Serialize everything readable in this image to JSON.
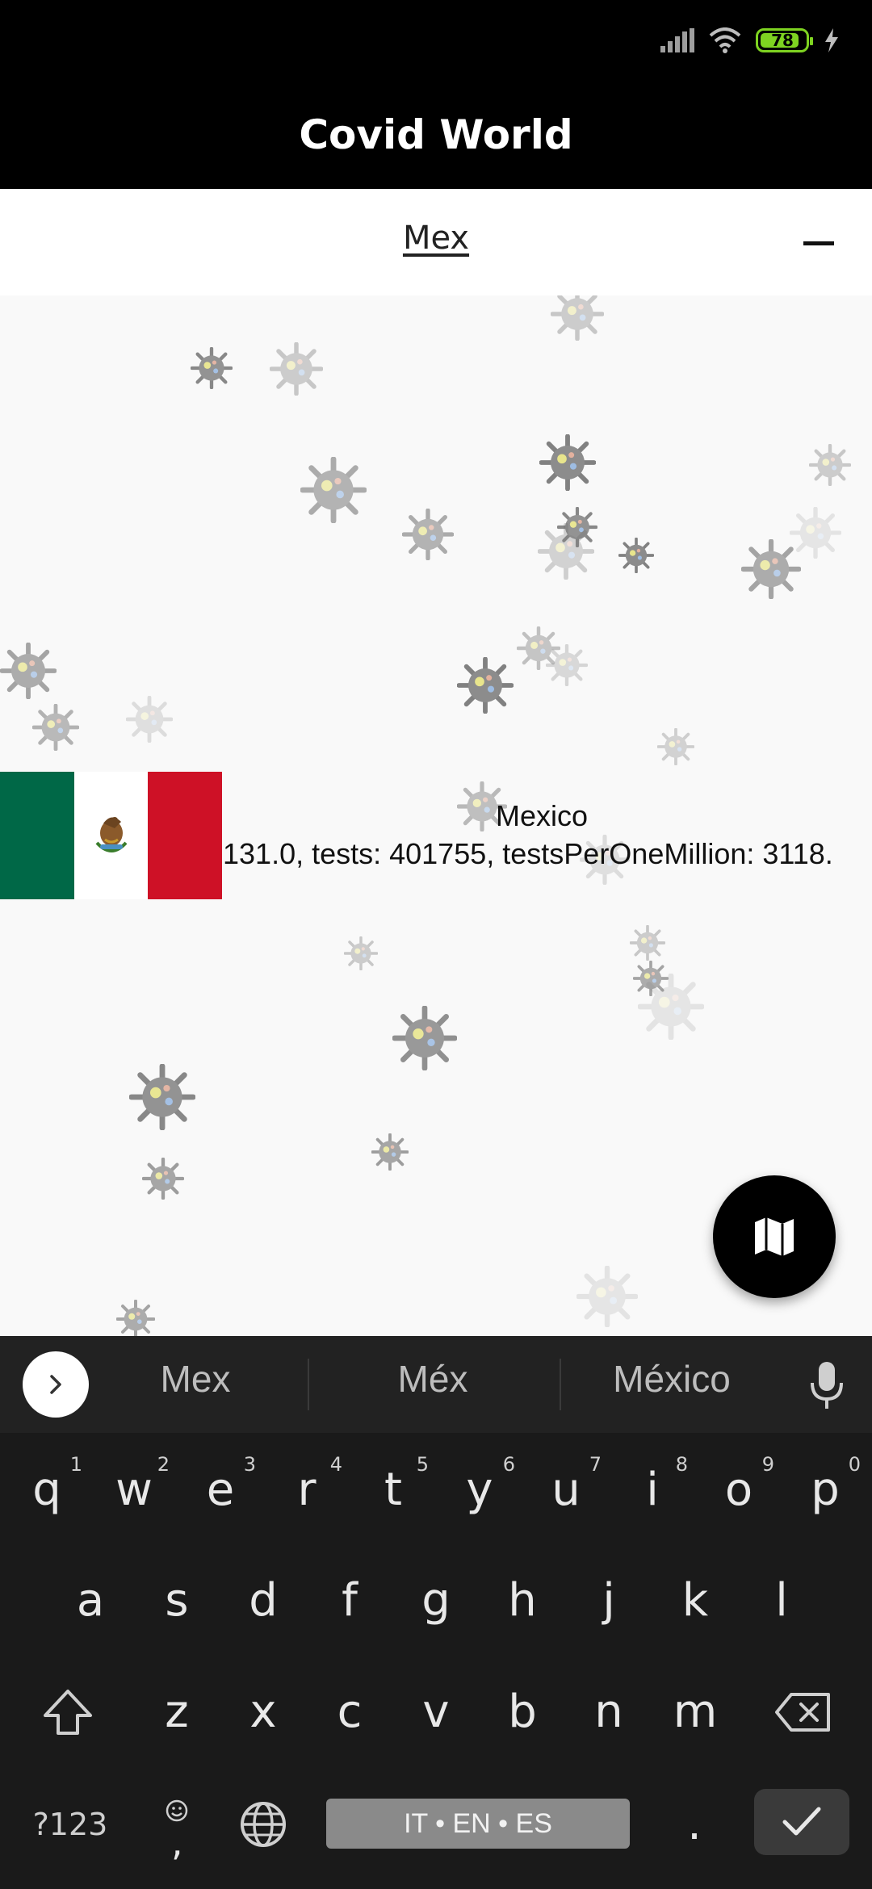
{
  "status_bar": {
    "battery_level": "78"
  },
  "app_bar": {
    "title": "Covid World"
  },
  "search": {
    "query": "Mex"
  },
  "country": {
    "name": "Mexico",
    "stats": "131.0, tests: 401755, testsPerOneMillion: 3118."
  },
  "fab": {
    "icon": "map-icon"
  },
  "keyboard": {
    "suggestions": [
      "Mex",
      "Méx",
      "México"
    ],
    "row1": [
      {
        "k": "q",
        "n": "1"
      },
      {
        "k": "w",
        "n": "2"
      },
      {
        "k": "e",
        "n": "3"
      },
      {
        "k": "r",
        "n": "4"
      },
      {
        "k": "t",
        "n": "5"
      },
      {
        "k": "y",
        "n": "6"
      },
      {
        "k": "u",
        "n": "7"
      },
      {
        "k": "i",
        "n": "8"
      },
      {
        "k": "o",
        "n": "9"
      },
      {
        "k": "p",
        "n": "0"
      }
    ],
    "row2": [
      "a",
      "s",
      "d",
      "f",
      "g",
      "h",
      "j",
      "k",
      "l"
    ],
    "row3": [
      "z",
      "x",
      "c",
      "v",
      "b",
      "n",
      "m"
    ],
    "symbols_label": "?123",
    "comma_label": ",",
    "period_label": ".",
    "space_label": "IT • EN • ES"
  }
}
